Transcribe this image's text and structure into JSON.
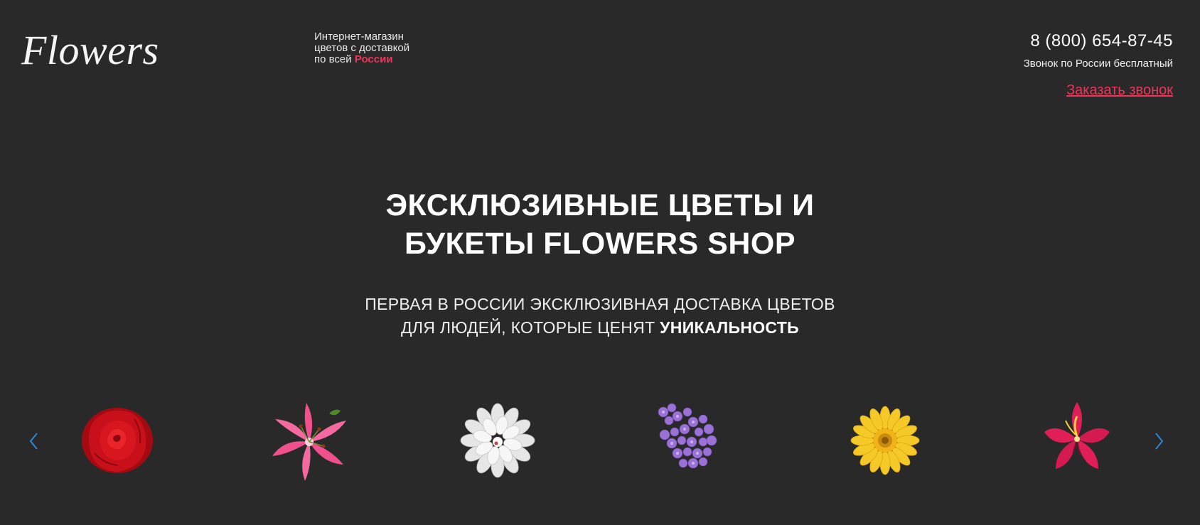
{
  "header": {
    "logo": "Flowers",
    "tagline_line1": "Интернет-магазин",
    "tagline_line2": "цветов с доставкой",
    "tagline_line3_prefix": "по всей",
    "tagline_accent": "России",
    "phone": "8 (800) 654-87-45",
    "phone_note": "Звонок по России бесплатный",
    "callback_label": "Заказать звонок"
  },
  "hero": {
    "title_line1": "ЭКСКЛЮЗИВНЫЕ ЦВЕТЫ И",
    "title_line2": "БУКЕТЫ FLOWERS SHOP",
    "subtitle_line1": "ПЕРВАЯ В РОССИИ ЭКСКЛЮЗИВНАЯ ДОСТАВКА ЦВЕТОВ",
    "subtitle_line2_prefix": "ДЛЯ ЛЮДЕЙ, КОТОРЫЕ ЦЕНЯТ",
    "subtitle_emphasis": "УНИКАЛЬНОСТЬ"
  },
  "slider": {
    "prev_icon": "chevron-left-icon",
    "next_icon": "chevron-right-icon",
    "arrow_color": "#2f86d6",
    "flowers": [
      {
        "name": "rose",
        "color": "#c8101a"
      },
      {
        "name": "lily",
        "color": "#f0508c"
      },
      {
        "name": "dahlia",
        "color": "#f2f2f2"
      },
      {
        "name": "lilac",
        "color": "#9a72d6"
      },
      {
        "name": "gerbera",
        "color": "#f5c928"
      },
      {
        "name": "alstroemeria",
        "color": "#e01e58"
      }
    ]
  },
  "colors": {
    "background": "#292929",
    "accent": "#f0345a"
  }
}
